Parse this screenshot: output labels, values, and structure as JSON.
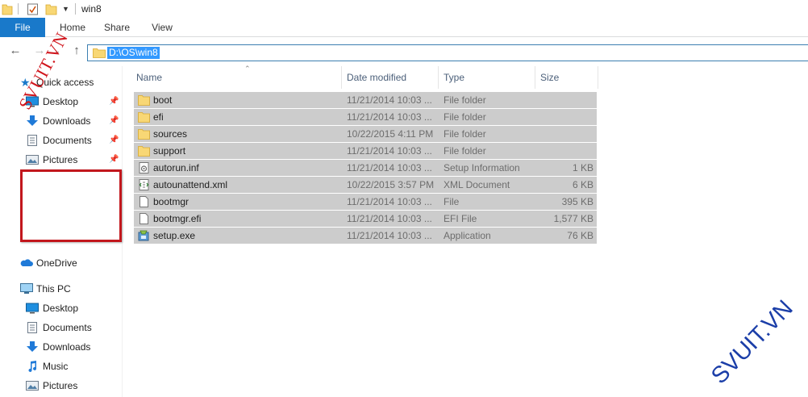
{
  "window": {
    "title": "win8"
  },
  "ribbon": {
    "tabs": [
      {
        "label": "File"
      },
      {
        "label": "Home"
      },
      {
        "label": "Share"
      },
      {
        "label": "View"
      }
    ]
  },
  "address": {
    "path": "D:\\OS\\win8"
  },
  "nav": {
    "quick_access": "Quick access",
    "quick_items": [
      {
        "label": "Desktop",
        "icon": "desktop-icon"
      },
      {
        "label": "Downloads",
        "icon": "downloads-icon"
      },
      {
        "label": "Documents",
        "icon": "documents-icon"
      },
      {
        "label": "Pictures",
        "icon": "pictures-icon"
      }
    ],
    "onedrive": "OneDrive",
    "this_pc": "This PC",
    "pc_items": [
      {
        "label": "Desktop",
        "icon": "desktop-icon"
      },
      {
        "label": "Documents",
        "icon": "documents-icon"
      },
      {
        "label": "Downloads",
        "icon": "downloads-icon"
      },
      {
        "label": "Music",
        "icon": "music-icon"
      },
      {
        "label": "Pictures",
        "icon": "pictures-icon"
      }
    ]
  },
  "columns": {
    "name": "Name",
    "date": "Date modified",
    "type": "Type",
    "size": "Size"
  },
  "files": [
    {
      "name": "boot",
      "date": "11/21/2014 10:03 ...",
      "type": "File folder",
      "size": "",
      "icon": "folder-icon"
    },
    {
      "name": "efi",
      "date": "11/21/2014 10:03 ...",
      "type": "File folder",
      "size": "",
      "icon": "folder-icon"
    },
    {
      "name": "sources",
      "date": "10/22/2015 4:11 PM",
      "type": "File folder",
      "size": "",
      "icon": "folder-icon"
    },
    {
      "name": "support",
      "date": "11/21/2014 10:03 ...",
      "type": "File folder",
      "size": "",
      "icon": "folder-icon"
    },
    {
      "name": "autorun.inf",
      "date": "11/21/2014 10:03 ...",
      "type": "Setup Information",
      "size": "1 KB",
      "icon": "setup-info-icon"
    },
    {
      "name": "autounattend.xml",
      "date": "10/22/2015 3:57 PM",
      "type": "XML Document",
      "size": "6 KB",
      "icon": "xml-document-icon"
    },
    {
      "name": "bootmgr",
      "date": "11/21/2014 10:03 ...",
      "type": "File",
      "size": "395 KB",
      "icon": "file-icon"
    },
    {
      "name": "bootmgr.efi",
      "date": "11/21/2014 10:03 ...",
      "type": "EFI File",
      "size": "1,577 KB",
      "icon": "file-icon"
    },
    {
      "name": "setup.exe",
      "date": "11/21/2014 10:03 ...",
      "type": "Application",
      "size": "76 KB",
      "icon": "setup-exe-icon"
    }
  ],
  "watermarks": [
    "SVUIT.VN",
    "SVUIT.VN"
  ],
  "colors": {
    "file_tab": "#1979ca",
    "selection": "#cccccc",
    "address_highlight": "#3399ff",
    "red_box": "#c2171d",
    "watermark_red": "#d0141b",
    "watermark_blue": "#1b3ea8",
    "folder": "#f8d775"
  }
}
